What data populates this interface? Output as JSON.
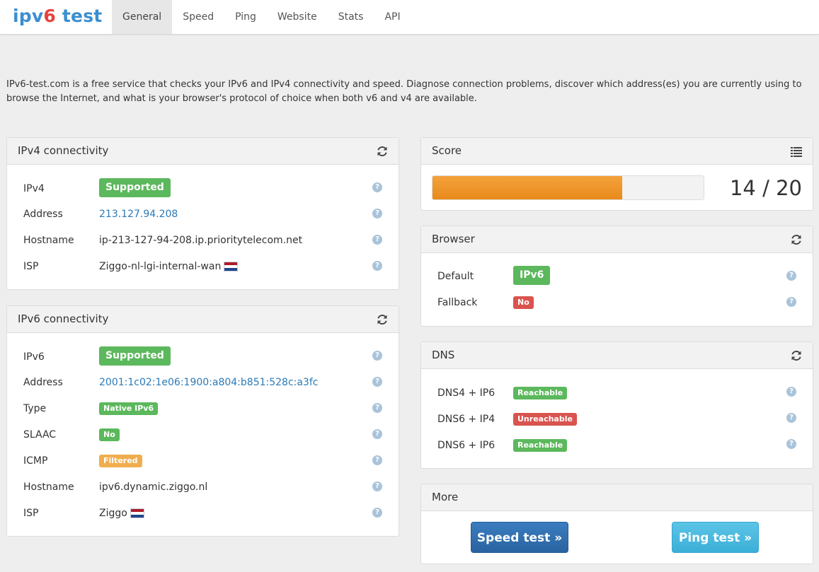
{
  "brand": {
    "part1": "ipv",
    "part2": "6",
    "part3": " test"
  },
  "nav": [
    {
      "label": "General",
      "active": true
    },
    {
      "label": "Speed"
    },
    {
      "label": "Ping"
    },
    {
      "label": "Website"
    },
    {
      "label": "Stats"
    },
    {
      "label": "API"
    }
  ],
  "intro": "IPv6-test.com is a free service that checks your IPv6 and IPv4 connectivity and speed. Diagnose connection problems, discover which address(es) you are currently using to browse the Internet, and what is your browser's protocol of choice when both v6 and v4 are available.",
  "ipv4": {
    "title": "IPv4 connectivity",
    "header_icon": "refresh-icon",
    "rows": [
      {
        "label": "IPv4",
        "value": "Supported",
        "kind": "badge-green"
      },
      {
        "label": "Address",
        "value": "213.127.94.208",
        "kind": "link"
      },
      {
        "label": "Hostname",
        "value": "ip-213-127-94-208.ip.prioritytelecom.net",
        "kind": "text"
      },
      {
        "label": "ISP",
        "value": "Ziggo-nl-lgi-internal-wan",
        "kind": "text-flag"
      }
    ]
  },
  "ipv6": {
    "title": "IPv6 connectivity",
    "header_icon": "refresh-icon",
    "rows": [
      {
        "label": "IPv6",
        "value": "Supported",
        "kind": "badge-green"
      },
      {
        "label": "Address",
        "value": "2001:1c02:1e06:1900:a804:b851:528c:a3fc",
        "kind": "link"
      },
      {
        "label": "Type",
        "value": "Native IPv6",
        "kind": "badge-green-small"
      },
      {
        "label": "SLAAC",
        "value": "No",
        "kind": "badge-green-small"
      },
      {
        "label": "ICMP",
        "value": "Filtered",
        "kind": "badge-orange-small"
      },
      {
        "label": "Hostname",
        "value": "ipv6.dynamic.ziggo.nl",
        "kind": "text"
      },
      {
        "label": "ISP",
        "value": "Ziggo",
        "kind": "text-flag"
      }
    ]
  },
  "score": {
    "title": "Score",
    "header_icon": "list-icon",
    "value": 14,
    "max": 20,
    "text": "14 / 20",
    "bar_color": "#ee9122"
  },
  "browser": {
    "title": "Browser",
    "header_icon": "refresh-icon",
    "rows": [
      {
        "label": "Default",
        "value": "IPv6",
        "kind": "badge-green"
      },
      {
        "label": "Fallback",
        "value": "No",
        "kind": "badge-red-small"
      }
    ]
  },
  "dns": {
    "title": "DNS",
    "header_icon": "refresh-icon",
    "rows": [
      {
        "label": "DNS4 + IP6",
        "value": "Reachable",
        "kind": "badge-green-small"
      },
      {
        "label": "DNS6 + IP4",
        "value": "Unreachable",
        "kind": "badge-red-small"
      },
      {
        "label": "DNS6 + IP6",
        "value": "Reachable",
        "kind": "badge-green-small"
      }
    ]
  },
  "more": {
    "title": "More",
    "speed_button": "Speed test »",
    "ping_button": "Ping test »"
  },
  "help_symbol": "?",
  "colors": {
    "link": "#2a7ab8",
    "green": "#5cb85c",
    "red": "#d9534f",
    "orange": "#f0ad4e"
  }
}
